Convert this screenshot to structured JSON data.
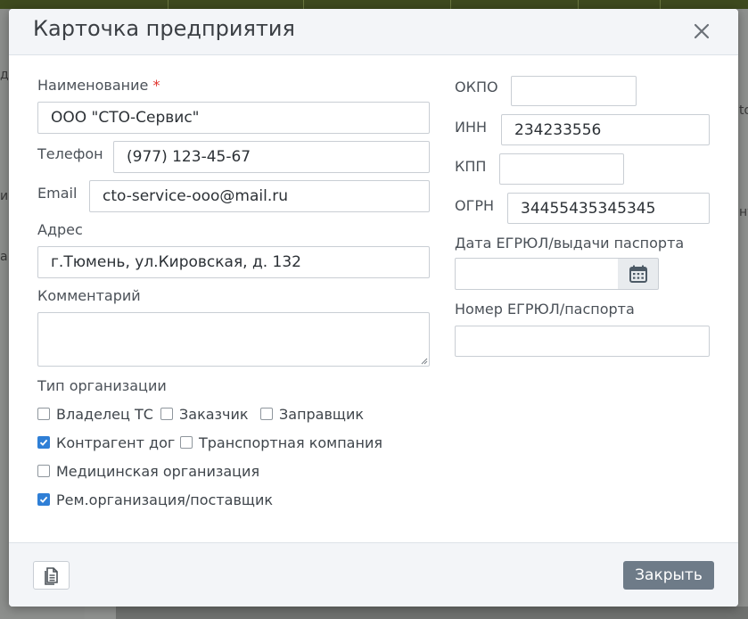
{
  "background": {
    "fragments": [
      "д",
      "и",
      "а",
      "to",
      "ну"
    ]
  },
  "dialog": {
    "title": "Карточка предприятия",
    "close_icon": "close-icon"
  },
  "form": {
    "name": {
      "label": "Наименование",
      "required_mark": "*",
      "value": "ООО \"СТО-Сервис\""
    },
    "phone": {
      "label": "Телефон",
      "value": "(977) 123-45-67"
    },
    "email": {
      "label": "Email",
      "value": "cto-service-ooo@mail.ru"
    },
    "address": {
      "label": "Адрес",
      "value": "г.Тюмень, ул.Кировская, д. 132"
    },
    "comment": {
      "label": "Комментарий",
      "value": ""
    },
    "org_type": {
      "label": "Тип организации",
      "options": [
        {
          "label": "Владелец ТС",
          "checked": false
        },
        {
          "label": "Заказчик",
          "checked": false
        },
        {
          "label": "Заправщик",
          "checked": false
        },
        {
          "label": "Контрагент дог",
          "checked": true
        },
        {
          "label": "Транспортная компания",
          "checked": false
        },
        {
          "label": "Медицинская организация",
          "checked": false
        },
        {
          "label": "Рем.организация/поставщик",
          "checked": true
        }
      ]
    },
    "okpo": {
      "label": "ОКПО",
      "value": ""
    },
    "inn": {
      "label": "ИНН",
      "value": "234233556"
    },
    "kpp": {
      "label": "КПП",
      "value": ""
    },
    "ogrn": {
      "label": "ОГРН",
      "value": "34455435345345"
    },
    "egrul_date": {
      "label": "Дата ЕГРЮЛ/выдачи паспорта",
      "value": "",
      "icon": "calendar-icon"
    },
    "egrul_number": {
      "label": "Номер ЕГРЮЛ/паспорта",
      "value": ""
    }
  },
  "footer": {
    "doc_icon": "document-icon",
    "close_label": "Закрыть"
  },
  "colors": {
    "accent_checkbox": "#2f7fd6",
    "close_button": "#6e7b88",
    "required": "#e0312b"
  }
}
